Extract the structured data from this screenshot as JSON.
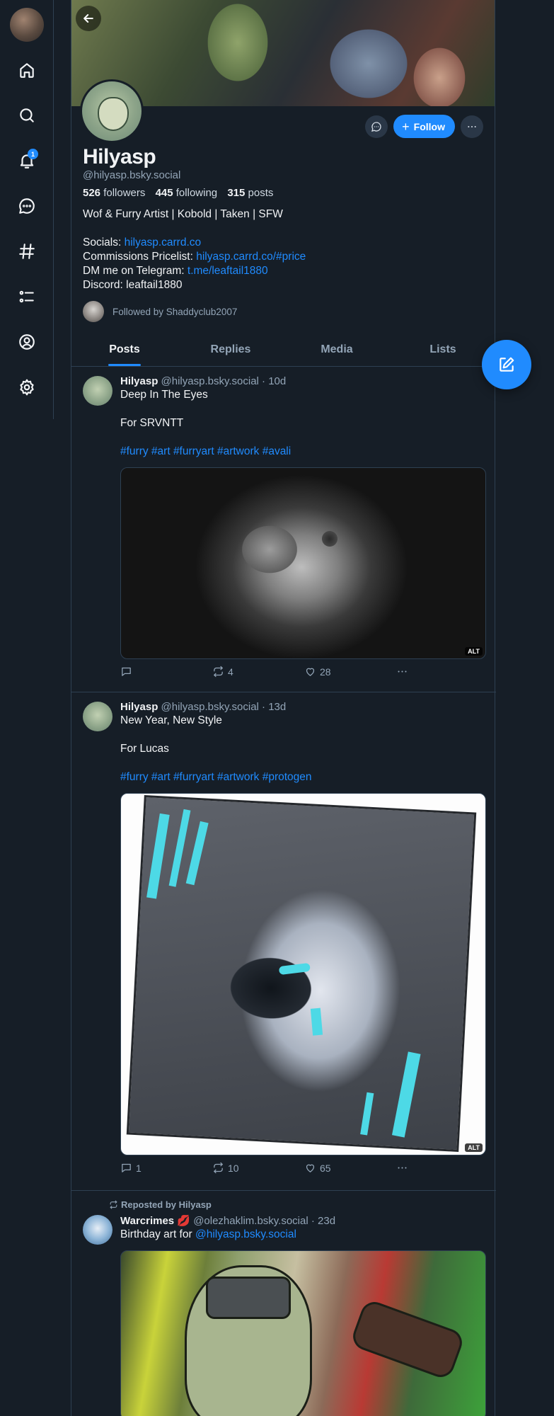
{
  "nav": {
    "notification_count": "1"
  },
  "profile": {
    "display_name": "Hilyasp",
    "handle": "@hilyasp.bsky.social",
    "followers_count": "526",
    "followers_label": "followers",
    "following_count": "445",
    "following_label": "following",
    "posts_count": "315",
    "posts_label": "posts",
    "follow_label": "Follow",
    "bio_line1": "Wof & Furry Artist | Kobold | Taken | SFW",
    "socials_label": "Socials: ",
    "socials_link": "hilyasp.carrd.co",
    "commissions_label": "Commissions Pricelist: ",
    "commissions_link": "hilyasp.carrd.co/#price",
    "telegram_label": "DM me on Telegram: ",
    "telegram_link": "t.me/leaftail1880",
    "discord_line": "Discord: leaftail1880",
    "followed_by": "Followed by Shaddyclub2007"
  },
  "tabs": [
    "Posts",
    "Replies",
    "Media",
    "Lists"
  ],
  "posts": [
    {
      "author": "Hilyasp",
      "handle": "@hilyasp.bsky.social",
      "age": "· 10d",
      "line1": "Deep In The Eyes",
      "line2": "For SRVNTT",
      "tags": "#furry #art #furryart #artwork #avali",
      "alt": "ALT",
      "replies": "",
      "reposts": "4",
      "likes": "28"
    },
    {
      "author": "Hilyasp",
      "handle": "@hilyasp.bsky.social",
      "age": "· 13d",
      "line1": "New Year, New Style",
      "line2": "For Lucas",
      "tags": "#furry #art #furryart #artwork #protogen",
      "alt": "ALT",
      "replies": "1",
      "reposts": "10",
      "likes": "65"
    },
    {
      "repost_label": "Reposted by Hilyasp",
      "author": "Warcrimes",
      "author_emoji": "💋",
      "handle": "@olezhaklim.bsky.social",
      "age": "· 23d",
      "line1_text": "Birthday art for ",
      "line1_mention": "@hilyasp.bsky.social"
    }
  ],
  "colors": {
    "background": "#161e27",
    "accent": "#208bfe",
    "muted_text": "#93a5b7",
    "border": "#2e4052"
  }
}
